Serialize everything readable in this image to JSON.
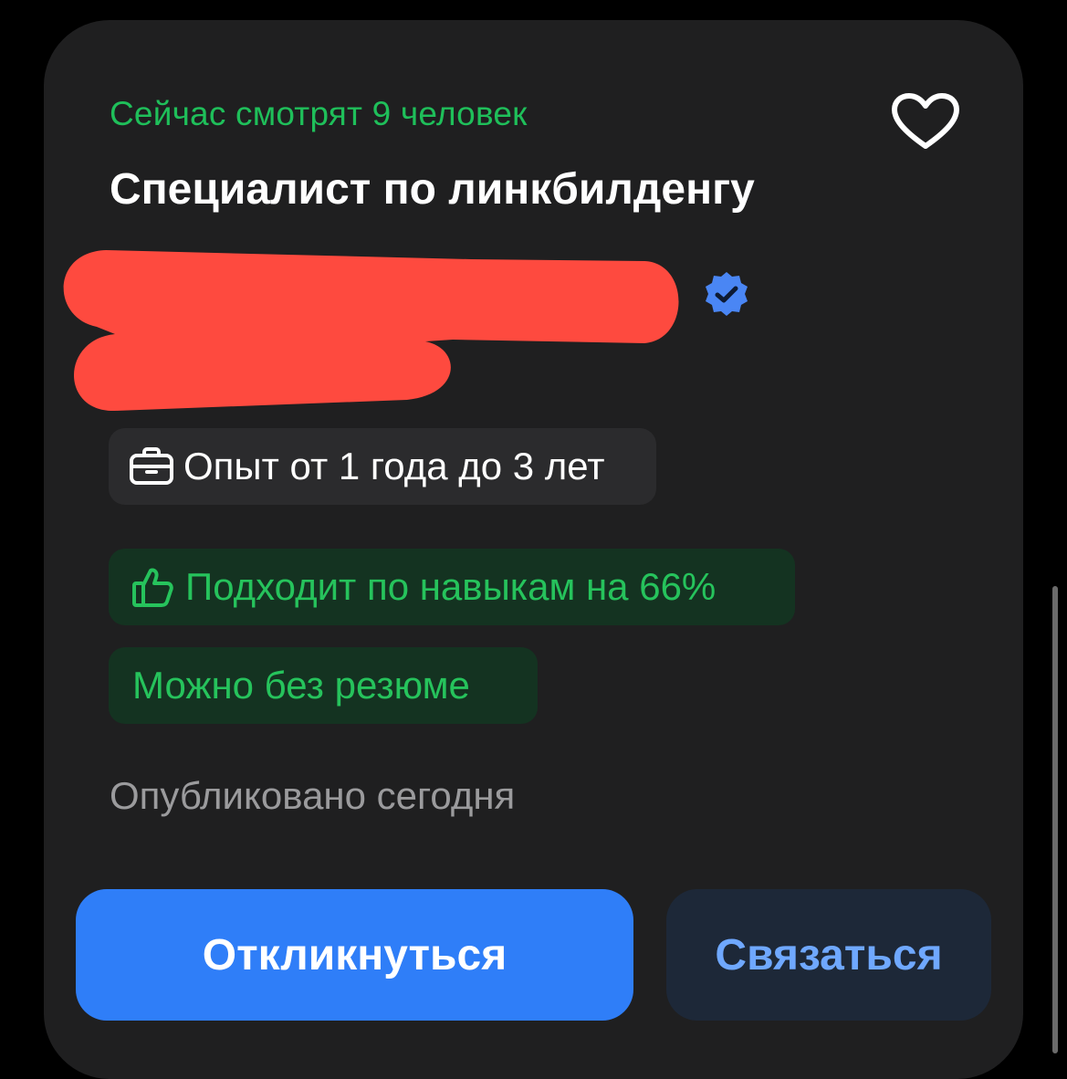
{
  "vacancy": {
    "viewers_text": "Сейчас смотрят 9 человек",
    "title": "Специалист по линкбилденгу",
    "experience": "Опыт от 1 года до 3 лет",
    "skills_match": "Подходит по навыкам на 66%",
    "no_resume": "Можно без резюме",
    "published": "Опубликовано сегодня"
  },
  "actions": {
    "apply_label": "Откликнуться",
    "contact_label": "Связаться"
  },
  "icons": {
    "favorite": "heart-outline-icon",
    "verified": "verified-badge-icon",
    "experience": "briefcase-icon",
    "skills": "thumbs-up-icon"
  },
  "colors": {
    "accent_green": "#26c35c",
    "primary_blue": "#2f7ef8",
    "secondary_button_text": "#6fa8ff",
    "card_background": "#1f1f20"
  }
}
